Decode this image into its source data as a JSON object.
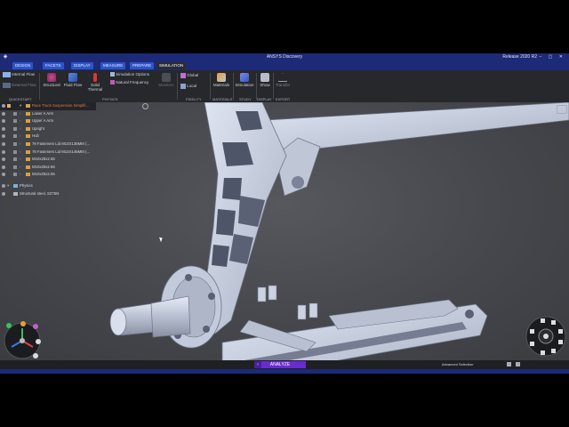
{
  "app": {
    "title": "ANSYS Discovery",
    "release": "Release 2020 R2",
    "window_controls": "– ▢ ✕"
  },
  "tabs": [
    {
      "label": "Design",
      "active": false
    },
    {
      "label": "Facets",
      "active": false
    },
    {
      "label": "Display",
      "active": false
    },
    {
      "label": "Measure",
      "active": false
    },
    {
      "label": "Prepare",
      "active": false
    },
    {
      "label": "Simulation",
      "active": true
    }
  ],
  "ribbon": {
    "flow_items": [
      "Internal Flow",
      "External Flow"
    ],
    "flow_group": "Quickstart",
    "physics": {
      "structural": "Structural",
      "fluid_flow": "Fluid Flow",
      "solid_thermal": "Solid Thermal",
      "sim_options": "Simulation Options",
      "natural_frequency": "Natural Frequency",
      "monitors": "Monitors",
      "group": "Physics"
    },
    "fidelity": {
      "global": "Global",
      "local": "Local",
      "group": "Fidelity"
    },
    "materials": {
      "label": "Materials",
      "group": "Materials"
    },
    "simulation": {
      "label": "Simulation",
      "group": "Study"
    },
    "show": {
      "label": "Show",
      "group": "Display"
    },
    "transfer": {
      "label": "Transfer",
      "group": "Export"
    }
  },
  "tree": {
    "rows": [
      {
        "label": "Race Truck Suspension Simplifi…",
        "selected": true
      },
      {
        "label": "Lower A Arm",
        "selected": false
      },
      {
        "label": "Upper A Arm",
        "selected": false
      },
      {
        "label": "Upright",
        "selected": false
      },
      {
        "label": "Hub",
        "selected": false
      },
      {
        "label": "78 Fasteners Lid M14X135MM (…",
        "selected": false
      },
      {
        "label": "78 Fasteners Lid M14X145MM (…",
        "selected": false
      },
      {
        "label": "M10x25x2.65",
        "selected": false
      },
      {
        "label": "M10x25x2.65",
        "selected": false
      },
      {
        "label": "M10x25x2.65",
        "selected": false
      }
    ],
    "physics_label": "Physics",
    "physics_item": "Structural steel, S275N"
  },
  "bottom": {
    "analyze": "Analyze",
    "analyze_arrow": "‹",
    "advanced_selection": "Advanced Selection"
  },
  "colors": {
    "title_bar": "#1c2a78",
    "tab_blue": "#2e54c8",
    "analyze_purple": "#6a2bd0",
    "selected_text": "#e87d2c",
    "part_color": "#c8cfe0"
  },
  "icons": [
    "ansys-logo-icon",
    "visibility-eye-icon",
    "folder-icon",
    "triad-axis-icon",
    "navigation-cube-icon",
    "pointer-cursor-icon"
  ]
}
